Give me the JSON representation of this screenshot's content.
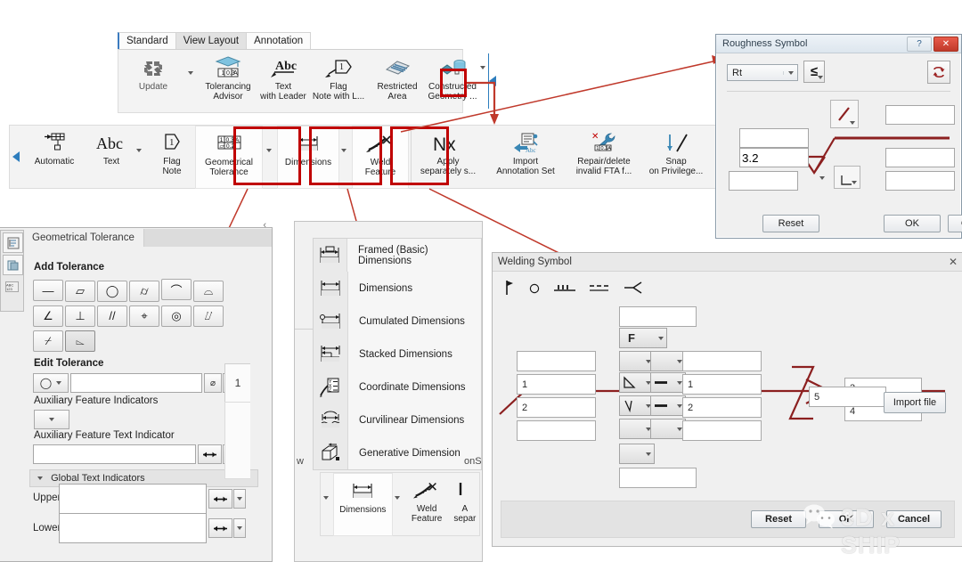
{
  "ribbon": {
    "tabs": [
      {
        "label": "Standard",
        "state": "first"
      },
      {
        "label": "View Layout",
        "state": "active"
      },
      {
        "label": "Annotation",
        "state": "plain"
      }
    ],
    "row1": [
      {
        "label": "Update",
        "icon": "refresh-icon",
        "has_dropdown": true
      },
      {
        "label": "Tolerancing\nAdvisor",
        "icon": "tolerancing-advisor-icon"
      },
      {
        "label": "Text\nwith Leader",
        "icon": "text-with-leader-icon"
      },
      {
        "label": "Flag\nNote with L...",
        "icon": "flag-note-icon"
      },
      {
        "label": "Restricted\nArea",
        "icon": "restricted-area-icon"
      },
      {
        "label": "Constructed\nGeometry ...",
        "icon": "constructed-geometry-icon",
        "has_dropdown": true
      }
    ],
    "collapse_arrow": "collapse-left-arrow",
    "row2": [
      {
        "label": "Automatic",
        "icon": "automatic-icon"
      },
      {
        "label": "Text",
        "icon": "text-abc-icon",
        "has_dropdown": true
      },
      {
        "label": "Flag\nNote",
        "icon": "flag-note-icon"
      },
      {
        "label": "Geometrical\nTolerance",
        "icon": "geometrical-tolerance-icon",
        "has_dropdown": true,
        "highlighted": true
      },
      {
        "label": "Dimensions",
        "icon": "dimensions-icon",
        "has_dropdown": true,
        "highlighted": true
      },
      {
        "label": "Weld\nFeature",
        "icon": "weld-feature-icon",
        "highlighted": true
      },
      {
        "label": "Apply\nseparately s...",
        "icon": "nx-icon"
      },
      {
        "label": "Import\nAnnotation Set",
        "icon": "import-annotation-icon"
      },
      {
        "label": "Repair/delete\ninvalid FTA f...",
        "icon": "repair-delete-icon"
      },
      {
        "label": "Snap\non Privilege...",
        "icon": "snap-privilege-icon"
      }
    ]
  },
  "gt_panel": {
    "tab_label": "Geometrical Tolerance",
    "add_tolerance_label": "Add Tolerance",
    "tolerance_symbols_row1": [
      "—",
      "▱",
      "◯",
      "⌭",
      "⌒",
      "⌓"
    ],
    "tolerance_symbols_row2": [
      "∠",
      "⊥",
      "//",
      "⌖",
      "◎",
      "⌰"
    ],
    "tolerance_symbols_row3": [
      "⌿",
      "⌳"
    ],
    "edit_tolerance_label": "Edit Tolerance",
    "edit_tolerance_symbol": "◯",
    "edit_tolerance_value": "",
    "edit_tolerance_modifier": "⌀",
    "datum_box_value": "1",
    "aux_feature_indicators_label": "Auxiliary Feature Indicators",
    "aux_feature_indicator_value": "",
    "aux_feature_text_indicator_label": "Auxiliary Feature Text Indicator",
    "aux_feature_text_value": "",
    "global_text_indicators_label": "Global Text Indicators",
    "upper_label": "Upper",
    "upper_value": "",
    "lower_label": "Lower",
    "lower_value": "",
    "rail_icons": [
      "tree-view-icon",
      "layers-icon",
      "abc-grid-icon"
    ]
  },
  "dim_menu": {
    "items": [
      {
        "label": "Framed (Basic) Dimensions",
        "icon": "framed-basic-dimensions-icon"
      },
      {
        "label": "Dimensions",
        "icon": "dimensions-icon"
      },
      {
        "label": "Cumulated Dimensions",
        "icon": "cumulated-dimensions-icon"
      },
      {
        "label": "Stacked Dimensions",
        "icon": "stacked-dimensions-icon"
      },
      {
        "label": "Coordinate Dimensions",
        "icon": "coordinate-dimensions-icon"
      },
      {
        "label": "Curvilinear Dimensions",
        "icon": "curvilinear-dimensions-icon"
      },
      {
        "label": "Generative Dimension",
        "icon": "generative-dimension-icon"
      }
    ],
    "mini_ribbon": [
      {
        "label": "Dimensions",
        "icon": "dimensions-icon",
        "has_dropdown": true
      },
      {
        "label": "Weld\nFeature",
        "icon": "weld-feature-icon"
      },
      {
        "label": "A\nsepar",
        "icon": "apply-separately-icon"
      }
    ],
    "edge_labels": {
      "left": "w",
      "right": "onS"
    }
  },
  "roughness_dialog": {
    "title": "Roughness Symbol",
    "help_button": "?",
    "close_button": "✕",
    "parameter_value": "Rt",
    "comparison_symbol": "≤",
    "flip_icon": "flip-symbol-icon",
    "field_top_right": "",
    "field_upper_left": "",
    "field_value": "3.2",
    "field_lower_left": "",
    "field_mid_right": "",
    "field_bottom_right": "",
    "symbol_triangle": "roughness-triangle-icon",
    "symbol_slash": "roughness-slash-icon",
    "symbol_corner": "roughness-corner-icon",
    "buttons": {
      "reset": "Reset",
      "ok": "OK",
      "cancel": "Cancel"
    }
  },
  "welding_dialog": {
    "title": "Welding Symbol",
    "close_button": "✕",
    "toolbar_icons": [
      "field-weld-flag-icon",
      "weld-all-around-icon",
      "weld-spacing-icon",
      "weld-dashes-icon",
      "weld-arrow-icon"
    ],
    "top_field": "",
    "process_dropdown": "F",
    "rows": [
      {
        "left": "",
        "sym1": "",
        "sym2": "",
        "right": ""
      },
      {
        "left": "1",
        "sym1": "fillet-weld-icon",
        "sym2": "flat-contour-icon",
        "right": "1"
      },
      {
        "left": "2",
        "sym1": "v-groove-weld-icon",
        "sym2": "flat-contour-icon",
        "right": "2"
      },
      {
        "left": "",
        "sym1": "",
        "sym2": "",
        "right": ""
      }
    ],
    "tail_fields": [
      "3",
      "4"
    ],
    "reference_field": "5",
    "import_button": "Import file",
    "bottom_dropdown": "",
    "bottom_field": "",
    "buttons": {
      "reset": "Reset",
      "ok": "OK",
      "cancel": "Cancel"
    }
  },
  "watermark": {
    "text": "3D x SHIP",
    "icon": "wechat-logo-icon"
  },
  "colors": {
    "highlight_red": "#c00000",
    "arrow_red": "#c0392b",
    "accent_blue": "#2d7dbd",
    "ribbon_bg": "#f3f3f3",
    "panel_bg": "#f0f0f0",
    "weld_line_red": "#8c2020"
  }
}
